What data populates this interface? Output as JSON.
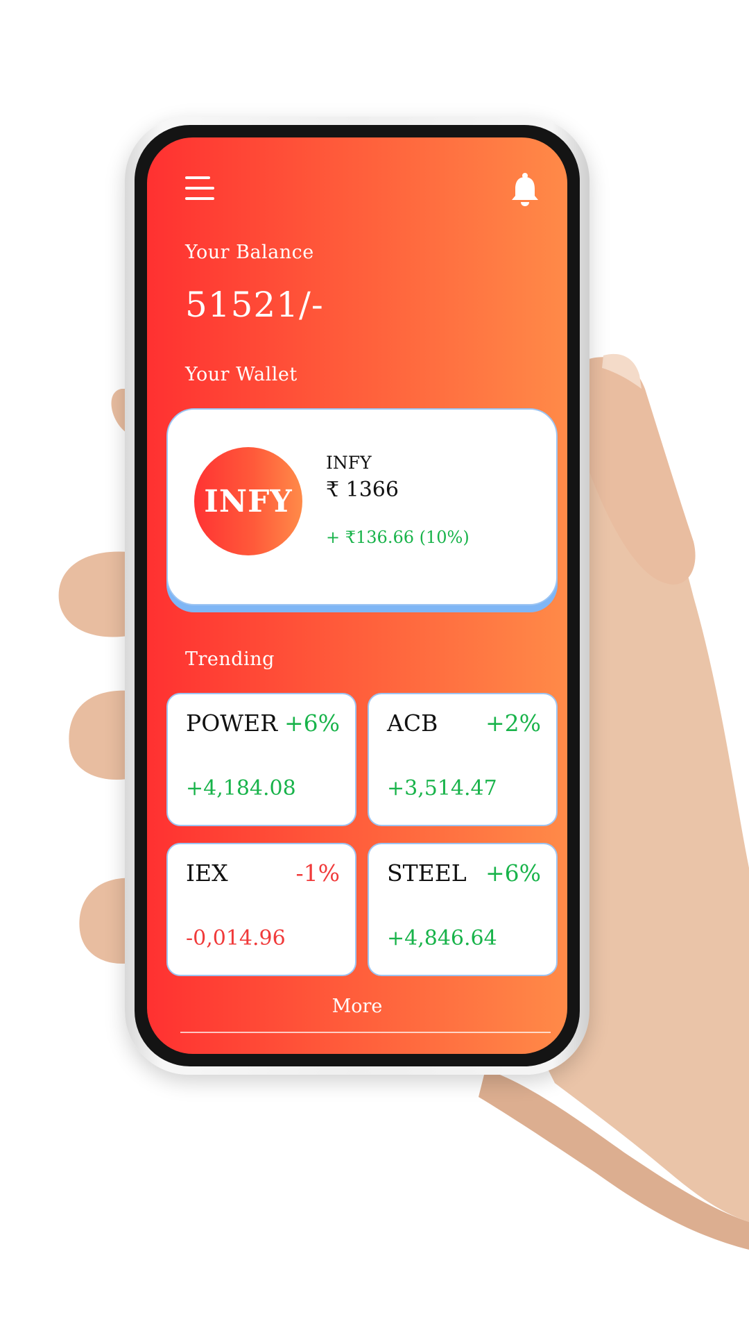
{
  "header": {
    "menu_icon": "hamburger-icon",
    "notification_icon": "bell-icon"
  },
  "balance": {
    "label": "Your Balance",
    "amount": "51521/-"
  },
  "wallet": {
    "label": "Your Wallet",
    "card": {
      "logo_text": "INFY",
      "symbol": "INFY",
      "price": "₹ 1366",
      "change": "+ ₹136.66 (10%)"
    }
  },
  "trending": {
    "label": "Trending",
    "items": [
      {
        "symbol": "POWER",
        "change_pct": "+6%",
        "value": "+4,184.08",
        "direction": "up"
      },
      {
        "symbol": "ACB",
        "change_pct": "+2%",
        "value": "+3,514.47",
        "direction": "up"
      },
      {
        "symbol": "IEX",
        "change_pct": "-1%",
        "value": "-0,014.96",
        "direction": "down"
      },
      {
        "symbol": "STEEL",
        "change_pct": "+6%",
        "value": "+4,846.64",
        "direction": "up"
      }
    ],
    "more_label": "More"
  },
  "colors": {
    "gradient_start": "#ff3131",
    "gradient_end": "#ff8a48",
    "positive": "#18b34a",
    "negative": "#f03a3a",
    "card_border": "#9cc4f2"
  }
}
